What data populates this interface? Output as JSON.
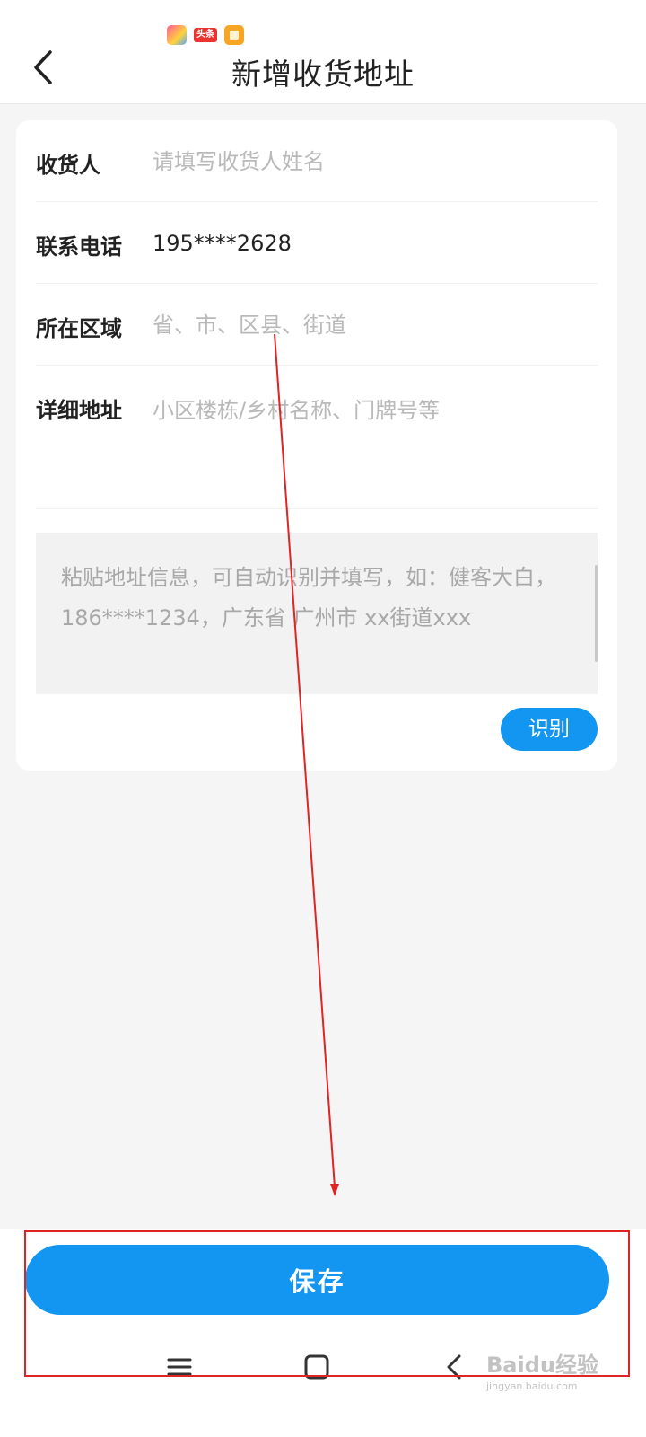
{
  "header": {
    "title": "新增收货地址",
    "status_icons": [
      "colorful-app-icon",
      "toutiao-icon",
      "notes-icon"
    ],
    "toutiao_label": "头条"
  },
  "form": {
    "rows": [
      {
        "label": "收货人",
        "value": "",
        "placeholder": "请填写收货人姓名"
      },
      {
        "label": "联系电话",
        "value": "195****2628",
        "placeholder": ""
      },
      {
        "label": "所在区域",
        "value": "",
        "placeholder": "省、市、区县、街道"
      },
      {
        "label": "详细地址",
        "value": "",
        "placeholder": "小区楼栋/乡村名称、门牌号等"
      }
    ],
    "paste_placeholder": "粘贴地址信息，可自动识别并填写，如：健客大白，186****1234，广东省 广州市 xx街道xxx",
    "recognize_label": "识别"
  },
  "footer": {
    "save_label": "保存",
    "nav": [
      "menu-icon",
      "home-icon",
      "back-icon"
    ]
  },
  "watermark": {
    "main": "Baidu经验",
    "sub": "jingyan.baidu.com"
  },
  "colors": {
    "accent": "#1296f1",
    "annotation": "#e02424",
    "background": "#f5f5f5"
  }
}
